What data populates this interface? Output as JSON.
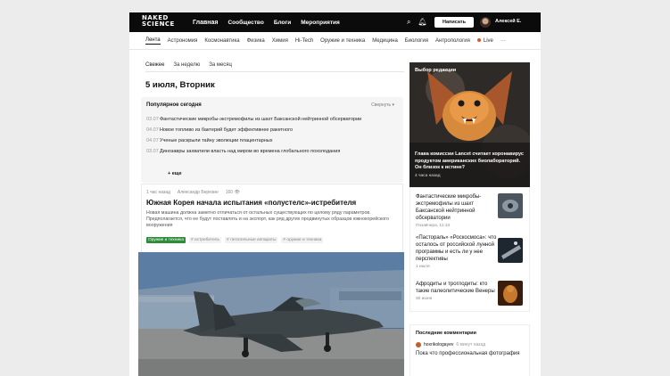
{
  "header": {
    "logo_line1": "NAKED",
    "logo_line2": "SCIENCE",
    "nav": [
      "Главная",
      "Сообщество",
      "Блоги",
      "Мероприятия"
    ],
    "write_label": "Написать",
    "username": "Алексей Е."
  },
  "subnav": {
    "items": [
      "Лента",
      "Астрономия",
      "Космонавтика",
      "Физика",
      "Химия",
      "Hi-Tech",
      "Оружие и техника",
      "Медицина",
      "Биология",
      "Антропология"
    ],
    "live": "Live",
    "more": "···"
  },
  "feed": {
    "tabs": [
      "Свежее",
      "За неделю",
      "За месяц"
    ],
    "date_heading": "5 июля, Вторник"
  },
  "popular": {
    "title": "Популярное сегодня",
    "collapse_label": "Свернуть",
    "items": [
      {
        "date": "03.07",
        "title": "Фантастические микробы-экстремофилы из шахт Баксанской нейтринной обсерватории"
      },
      {
        "date": "04.07",
        "title": "Новое топливо из бактерий будет эффективнее ракетного"
      },
      {
        "date": "04.07",
        "title": "Ученые раскрыли тайну эволюции плацентарных"
      },
      {
        "date": "03.07",
        "title": "Динозавры захватили власть над миром во времена глобального похолодания"
      }
    ],
    "more_label": "+ еще"
  },
  "article": {
    "time": "1 час назад",
    "author": "Александр Березин",
    "views": "160",
    "title": "Южная Корея начала испытания «полустелс»-истребителя",
    "lead": "Новая машина должна заметно отличаться от остальных существующих по целому ряду параметров. Предполагается, что ее будут поставлять и на экспорт, как ряд других продвинутых образцов южнокорейского вооружения",
    "main_tag": "Оружие и техника",
    "tags": [
      "# истребитель",
      "# летательные аппараты",
      "# оружие и техника"
    ]
  },
  "sidebar": {
    "editor_label": "Выбор редакции",
    "editor_title": "Глава комиссии Lancet считает коронавирус продуктом американских биолабораторий. Он близок к истине?",
    "editor_time": "4 часа назад",
    "news": [
      {
        "title": "Фантастические микробы-экстремофилы из шахт Баксанской нейтринной обсерватории",
        "time": "Позавчера, 11:13"
      },
      {
        "title": "«Пастораль» «Роскосмоса»: что осталось от российской лунной программы и есть ли у нее перспективы",
        "time": "1 июля"
      },
      {
        "title": "Афродиты и троглодиты: кто такие палеолитические Венеры",
        "time": "30 июня"
      }
    ],
    "comments_title": "Последние комментарии",
    "comment_user": "hoxrikologayev",
    "comment_time": "6 минут назад",
    "comment_text": "Пока что профессиональная фотография"
  }
}
